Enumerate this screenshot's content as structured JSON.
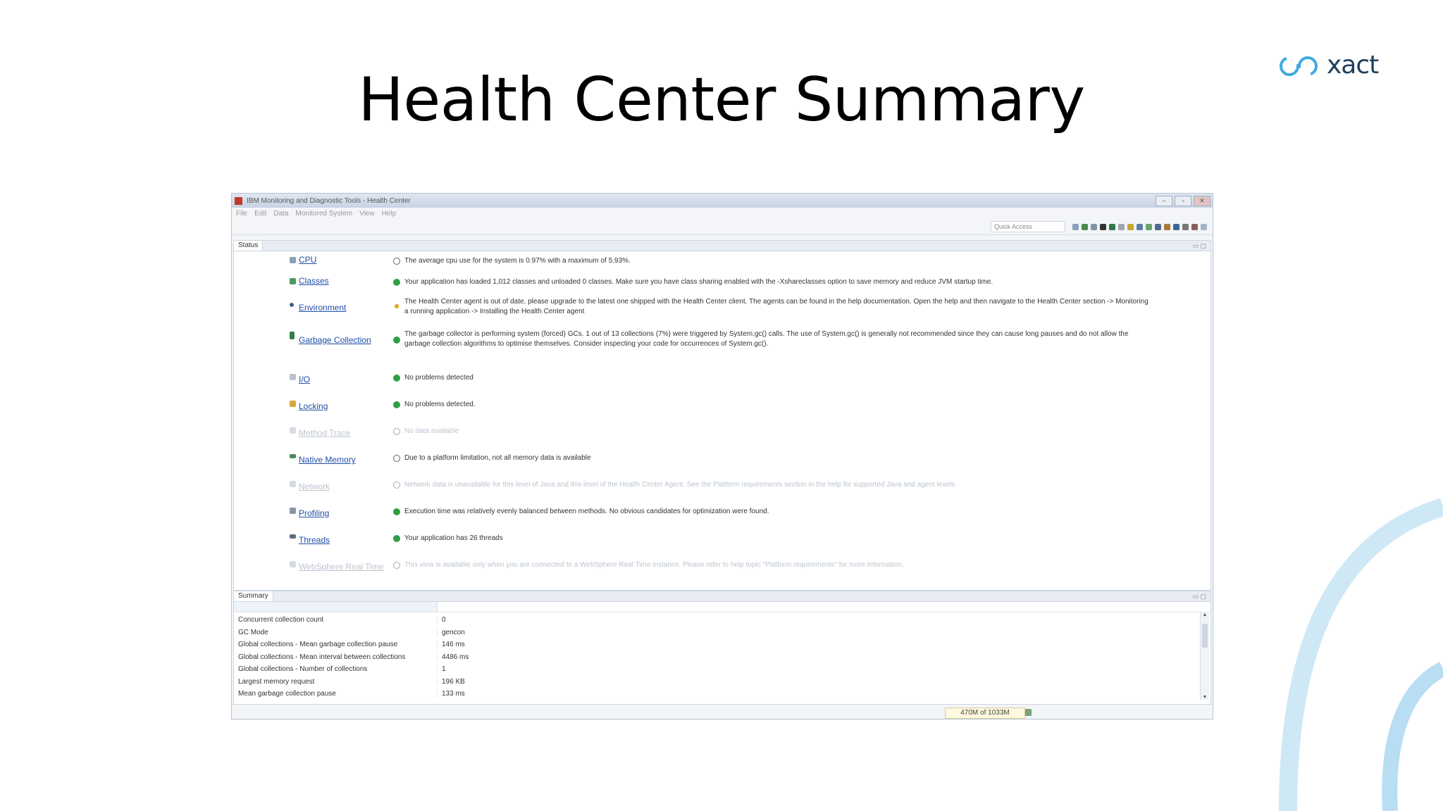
{
  "slide": {
    "title": "Health Center Summary",
    "logo_text": "xact"
  },
  "window": {
    "title": "IBM Monitoring and Diagnostic Tools - Health Center",
    "menu": [
      "File",
      "Edit",
      "Data",
      "Monitored System",
      "View",
      "Help"
    ],
    "quick_access_placeholder": "Quick Access",
    "status_tab": "Status",
    "summary_tab": "Summary",
    "heap_usage": "470M of 1033M"
  },
  "status_rows": [
    {
      "label": "CPU",
      "state": "info",
      "message": "The average cpu use for the system is 0.97% with a maximum of 5.93%."
    },
    {
      "label": "Classes",
      "state": "ok",
      "message": "Your application has loaded 1,012 classes and unloaded 0 classes. Make sure you have class sharing enabled with the -Xshareclasses option to save memory and reduce JVM startup time."
    },
    {
      "label": "Environment",
      "state": "warn",
      "message": "The Health Center agent is out of date, please upgrade to the latest one shipped with the Health Center client.  The agents can be found in the help documentation.  Open the help and then navigate to the Health Center section -> Monitoring a running application -> Installing the Health Center agent"
    },
    {
      "label": "Garbage Collection",
      "state": "ok",
      "message": "The garbage collector is performing system (forced) GCs. 1 out of 13 collections (7%) were triggered by System.gc() calls. The use of System.gc() is generally not recommended since they can cause long pauses and do not allow the garbage collection algorithms to optimise themselves. Consider inspecting your code for occurrences of System.gc()."
    },
    {
      "label": "I/O",
      "state": "ok",
      "message": "No problems detected"
    },
    {
      "label": "Locking",
      "state": "ok",
      "message": "No problems detected."
    },
    {
      "label": "Method Trace",
      "state": "na",
      "message": "No data available"
    },
    {
      "label": "Native Memory",
      "state": "info",
      "message": "Due to a platform limitation, not all memory data is available"
    },
    {
      "label": "Network",
      "state": "na",
      "message": "Network data is unavailable for this level of Java and this level of the Health Center Agent. See the Platform requirements section in the help for supported Java and agent levels."
    },
    {
      "label": "Profiling",
      "state": "ok",
      "message": "Execution time was relatively evenly balanced between methods. No obvious candidates for optimization were found."
    },
    {
      "label": "Threads",
      "state": "ok",
      "message": "Your application has 26 threads"
    },
    {
      "label": "WebSphere Real Time",
      "state": "na",
      "message": "This view is available only when you are connected to a WebSphere Real Time instance. Please refer to help topic \"Platform requirements\" for more information."
    }
  ],
  "summary_rows": [
    {
      "name": "Concurrent collection count",
      "value": "0"
    },
    {
      "name": "GC Mode",
      "value": "gencon"
    },
    {
      "name": "Global collections - Mean garbage collection pause",
      "value": "146 ms"
    },
    {
      "name": "Global collections - Mean interval between collections",
      "value": "4486 ms"
    },
    {
      "name": "Global collections - Number of collections",
      "value": "1"
    },
    {
      "name": "Largest memory request",
      "value": "196 KB"
    },
    {
      "name": "Mean garbage collection pause",
      "value": "133 ms"
    }
  ],
  "colors": {
    "link": "#1f4fa8",
    "ok": "#2e9e46",
    "warn": "#e0a417",
    "deco_arc": "#cfe8f6",
    "logo": "#1d3f5e"
  }
}
